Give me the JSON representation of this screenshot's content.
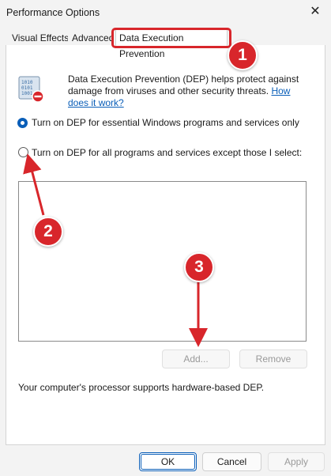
{
  "window": {
    "title": "Performance Options",
    "close_icon": "close-icon"
  },
  "tabs": [
    {
      "label": "Visual Effects"
    },
    {
      "label": "Advanced"
    },
    {
      "label": "Data Execution Prevention"
    }
  ],
  "dep": {
    "description": "Data Execution Prevention (DEP) helps protect against damage from viruses and other security threats.",
    "link_text": "How does it work?",
    "options": [
      {
        "label": "Turn on DEP for essential Windows programs and services only",
        "selected": true
      },
      {
        "label": "Turn on DEP for all programs and services except those I select:",
        "selected": false
      }
    ],
    "add_label": "Add...",
    "remove_label": "Remove",
    "processor_text": "Your computer's processor supports hardware-based DEP."
  },
  "footer": {
    "ok_label": "OK",
    "cancel_label": "Cancel",
    "apply_label": "Apply"
  },
  "annotations": {
    "badge1": "1",
    "badge2": "2",
    "badge3": "3",
    "color": "#d8262b"
  }
}
